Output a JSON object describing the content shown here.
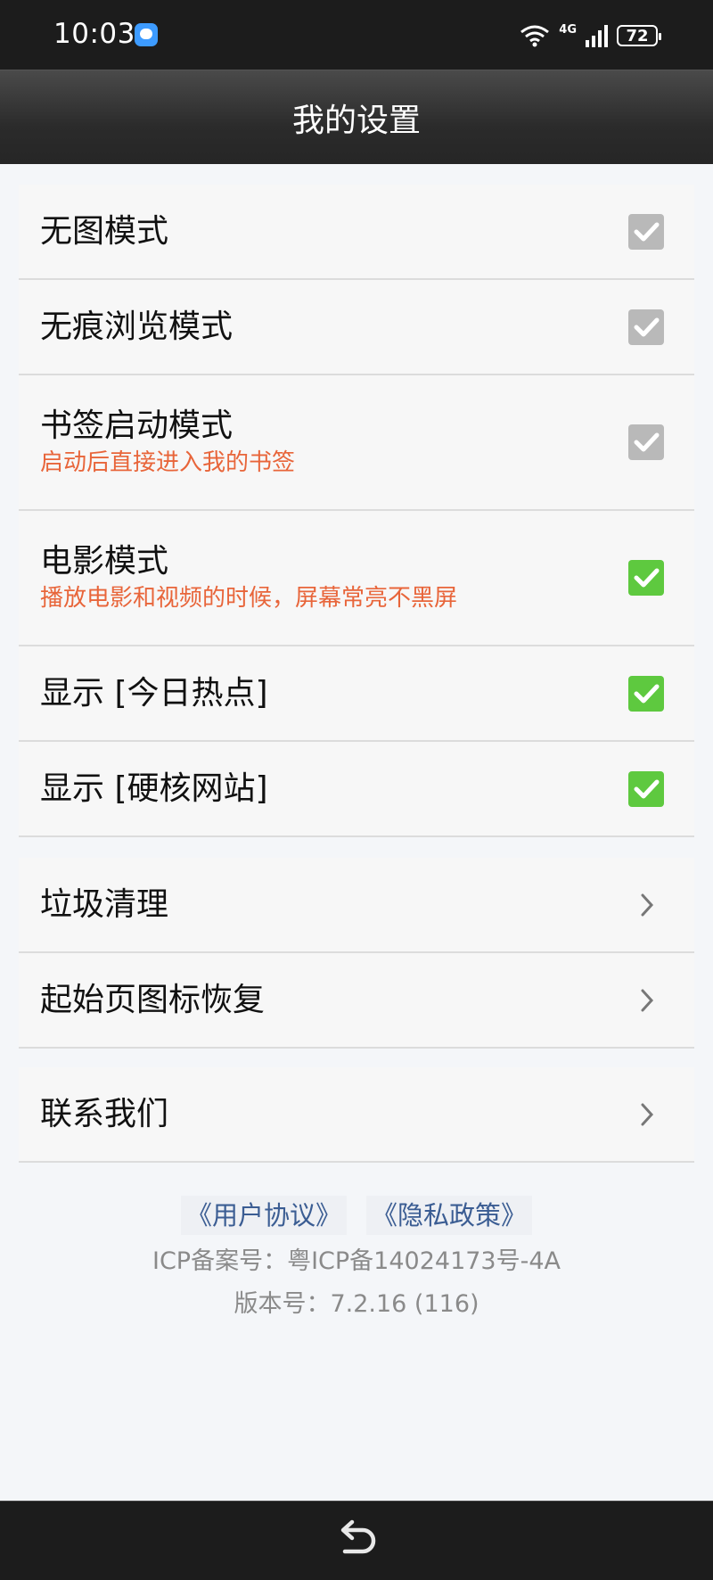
{
  "status_bar": {
    "time": "10:03",
    "network": "4G",
    "battery": "72"
  },
  "header": {
    "title": "我的设置"
  },
  "settings": [
    {
      "label": "无图模式",
      "checked": false
    },
    {
      "label": "无痕浏览模式",
      "checked": false
    },
    {
      "label": "书签启动模式",
      "sublabel": "启动后直接进入我的书签",
      "checked": false
    },
    {
      "label": "电影模式",
      "sublabel": "播放电影和视频的时候，屏幕常亮不黑屏",
      "checked": true
    },
    {
      "label": "显示 [今日热点]",
      "checked": true
    },
    {
      "label": "显示 [硬核网站]",
      "checked": true
    }
  ],
  "tools": [
    {
      "label": "垃圾清理"
    },
    {
      "label": "起始页图标恢复"
    }
  ],
  "contact": {
    "label": "联系我们"
  },
  "footer": {
    "user_agreement": "《用户协议》",
    "privacy_policy": "《隐私政策》",
    "icp": "ICP备案号：粤ICP备14024173号-4A",
    "version": "版本号：7.2.16 (116)"
  },
  "colors": {
    "checked": "#5ec93f",
    "unchecked": "#b9b9b9",
    "sublabel": "#e8653a",
    "link": "#3b5d93"
  },
  "icons": [
    "chat-app-icon",
    "wifi-icon",
    "signal-icon",
    "battery-icon",
    "checkmark-icon",
    "chevron-right-icon",
    "back-icon"
  ]
}
